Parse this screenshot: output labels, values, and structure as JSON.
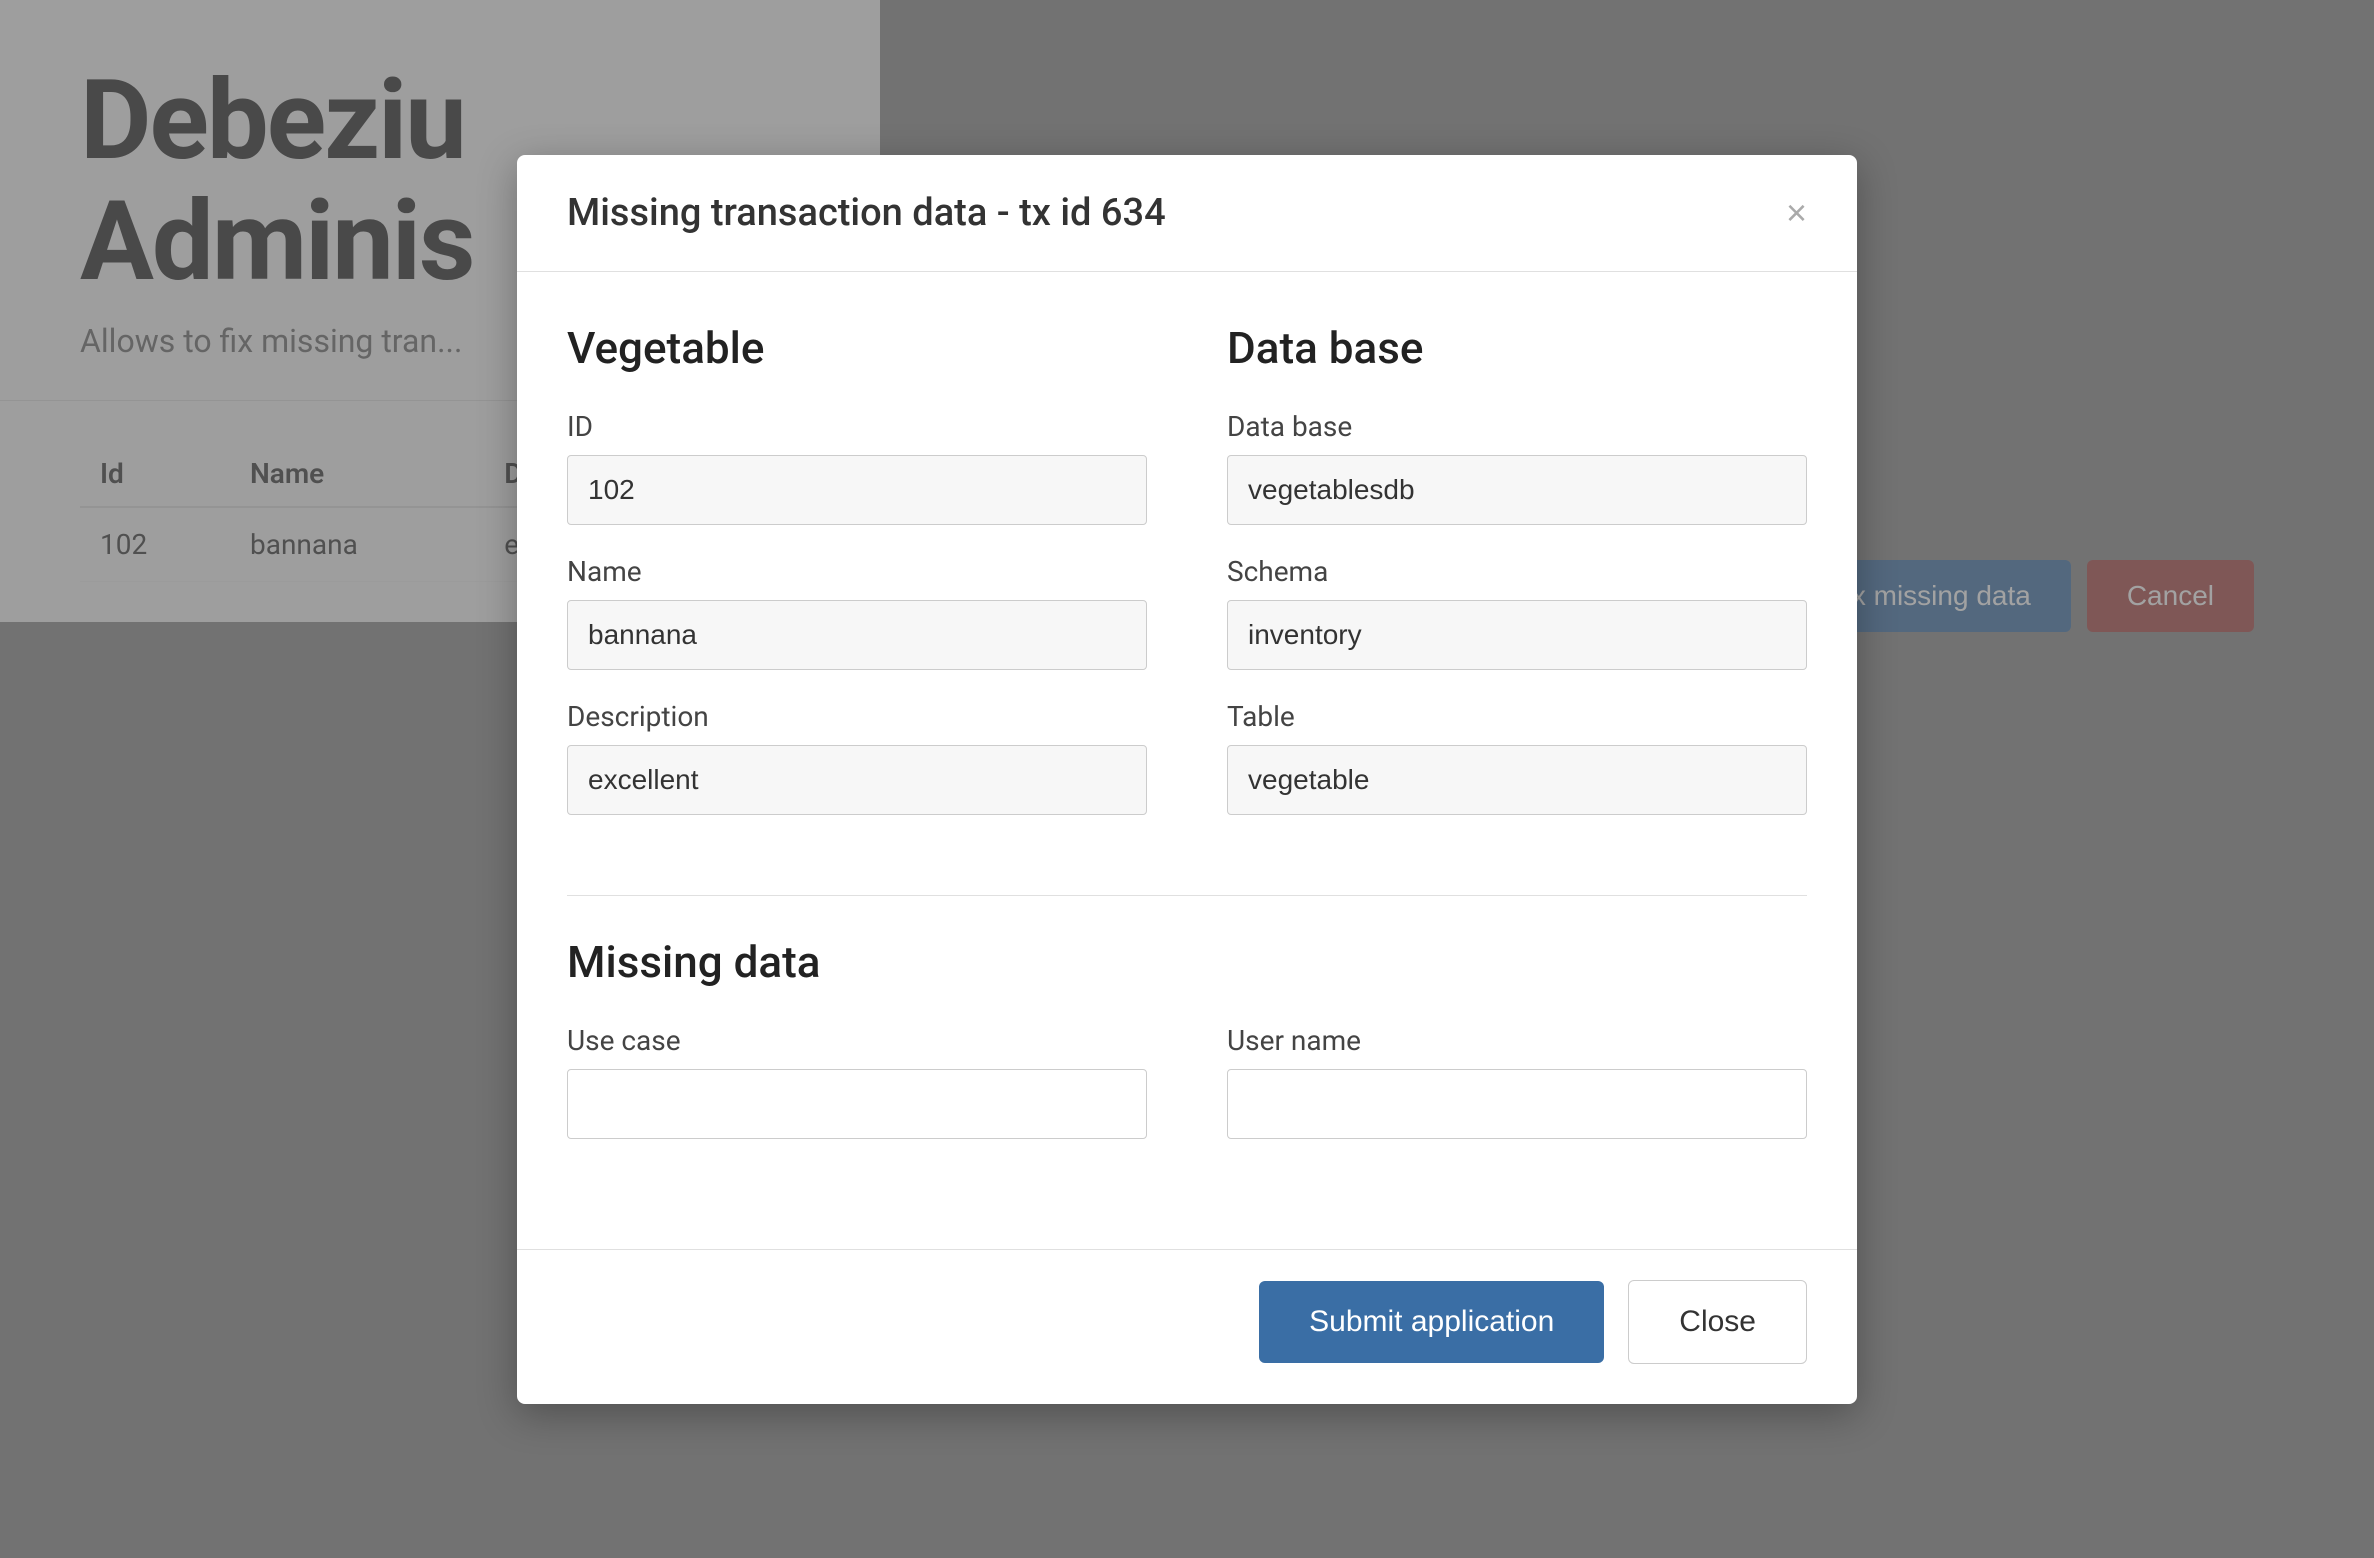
{
  "background": {
    "app_title_line1": "Debeziu",
    "app_title_line2": "Adminis",
    "app_subtitle": "Allows to fix missing tran...",
    "table": {
      "columns": [
        "Id",
        "Name",
        "Description"
      ],
      "rows": [
        {
          "id": "102",
          "name": "bannana",
          "description": "excellent"
        }
      ]
    },
    "fix_button_label": "Fix missing data",
    "cancel_button_label": "Cancel"
  },
  "modal": {
    "title": "Missing transaction data - tx id 634",
    "close_icon": "×",
    "vegetable_section": {
      "heading": "Vegetable",
      "id_label": "ID",
      "id_value": "102",
      "name_label": "Name",
      "name_value": "bannana",
      "description_label": "Description",
      "description_value": "excellent"
    },
    "database_section": {
      "heading": "Data base",
      "database_label": "Data base",
      "database_value": "vegetablesdb",
      "schema_label": "Schema",
      "schema_value": "inventory",
      "table_label": "Table",
      "table_value": "vegetable"
    },
    "missing_data_section": {
      "heading": "Missing data",
      "use_case_label": "Use case",
      "use_case_value": "",
      "use_case_placeholder": "",
      "user_name_label": "User name",
      "user_name_value": "",
      "user_name_placeholder": ""
    },
    "footer": {
      "submit_label": "Submit application",
      "close_label": "Close"
    }
  }
}
